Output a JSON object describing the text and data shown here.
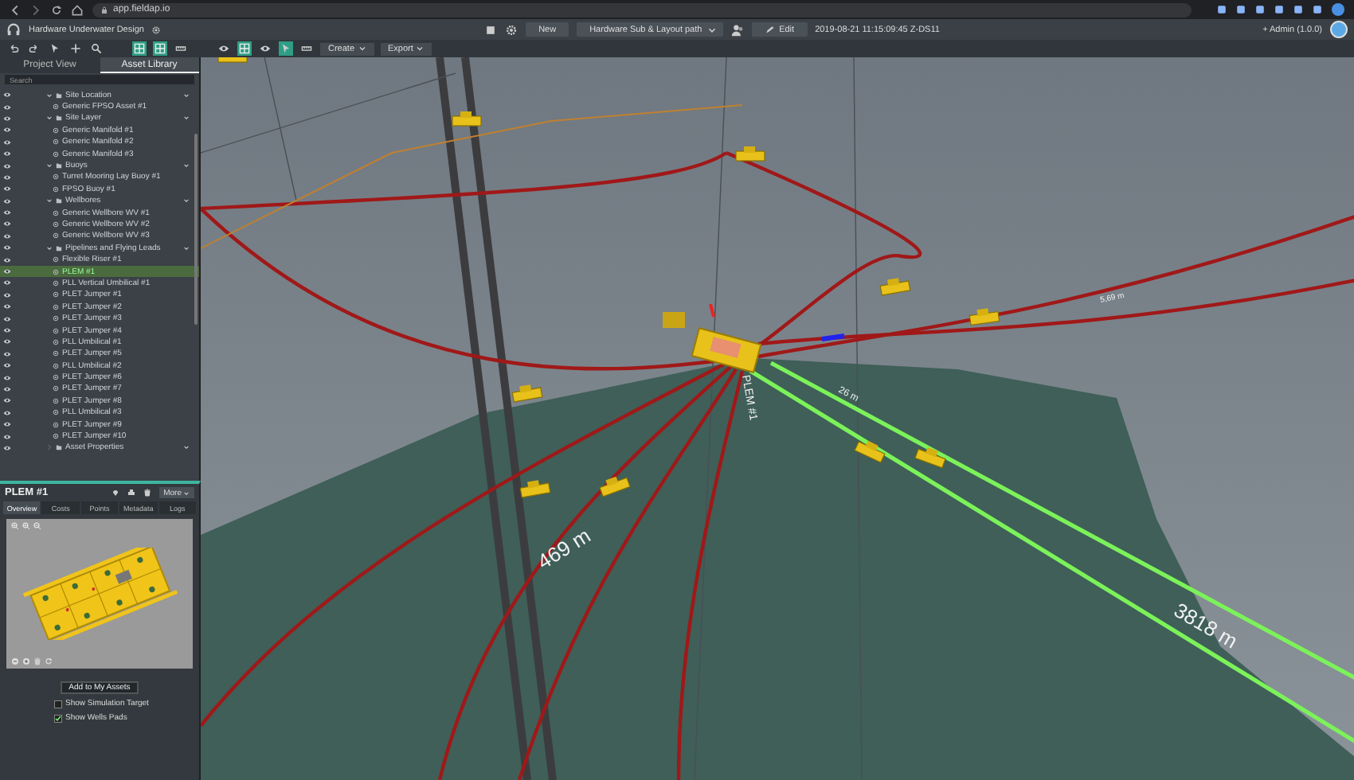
{
  "browser": {
    "url": "app.fieldap.io"
  },
  "header": {
    "project": "Hardware Underwater Design",
    "new_button": "New",
    "layout_select": "Hardware Sub & Layout path",
    "edit_button": "Edit",
    "timestamp": "2019-08-21 11:15:09:45 Z-DS11",
    "user": "+ Admin (1.0.0)"
  },
  "toolbar": {
    "tools": [
      {
        "kind": "undo",
        "selected": false
      },
      {
        "kind": "redo",
        "selected": false
      },
      {
        "kind": "pointer",
        "selected": false
      },
      {
        "kind": "pan",
        "selected": false
      },
      {
        "kind": "zoom",
        "selected": false
      },
      {
        "kind": "grid",
        "selected": true
      },
      {
        "kind": "grid",
        "selected": true
      },
      {
        "kind": "measure",
        "selected": false
      },
      {
        "kind": "eye",
        "selected": false
      },
      {
        "kind": "grid",
        "selected": true
      },
      {
        "kind": "eye",
        "selected": false
      },
      {
        "kind": "pointer",
        "selected": true
      },
      {
        "kind": "measure",
        "selected": false
      }
    ],
    "menus": [
      "Create",
      "Export"
    ]
  },
  "sidebar": {
    "tabs": [
      {
        "label": "Project View",
        "selected": false
      },
      {
        "label": "Asset Library",
        "selected": true
      }
    ],
    "search": {
      "placeholder": "Search"
    },
    "tree": [
      {
        "label": "Site Location",
        "expanded": true,
        "children": [
          {
            "label": "Generic FPSO Asset #1",
            "selected": false
          }
        ]
      },
      {
        "label": "Site Layer",
        "expanded": true,
        "children": [
          {
            "label": "Generic Manifold #1",
            "selected": false
          },
          {
            "label": "Generic Manifold #2",
            "selected": false
          },
          {
            "label": "Generic Manifold #3",
            "selected": false
          }
        ]
      },
      {
        "label": "Buoys",
        "expanded": true,
        "children": [
          {
            "label": "Turret Mooring Lay Buoy #1",
            "selected": false
          },
          {
            "label": "FPSO Buoy #1",
            "selected": false
          }
        ]
      },
      {
        "label": "Wellbores",
        "expanded": true,
        "children": [
          {
            "label": "Generic Wellbore WV #1",
            "selected": false
          },
          {
            "label": "Generic Wellbore WV #2",
            "selected": false
          },
          {
            "label": "Generic Wellbore WV #3",
            "selected": false
          }
        ]
      },
      {
        "label": "Pipelines and Flying Leads",
        "expanded": true,
        "children": [
          {
            "label": "Flexible Riser #1",
            "selected": false
          },
          {
            "label": "PLEM #1",
            "selected": true
          },
          {
            "label": "PLL Vertical Umbilical #1",
            "selected": false
          },
          {
            "label": "PLET Jumper #1",
            "selected": false
          },
          {
            "label": "PLET Jumper #2",
            "selected": false
          },
          {
            "label": "PLET Jumper #3",
            "selected": false
          },
          {
            "label": "PLET Jumper #4",
            "selected": false
          },
          {
            "label": "PLL Umbilical #1",
            "selected": false
          },
          {
            "label": "PLET Jumper #5",
            "selected": false
          },
          {
            "label": "PLL Umbilical #2",
            "selected": false
          },
          {
            "label": "PLET Jumper #6",
            "selected": false
          },
          {
            "label": "PLET Jumper #7",
            "selected": false
          },
          {
            "label": "PLET Jumper #8",
            "selected": false
          },
          {
            "label": "PLL Umbilical #3",
            "selected": false
          },
          {
            "label": "PLET Jumper #9",
            "selected": false
          },
          {
            "label": "PLET Jumper #10",
            "selected": false
          }
        ]
      },
      {
        "label": "Asset Properties",
        "expanded": false
      }
    ]
  },
  "asset_panel": {
    "title": "PLEM #1",
    "more_button": "More",
    "tabs": [
      {
        "label": "Overview",
        "selected": true
      },
      {
        "label": "Costs",
        "selected": false
      },
      {
        "label": "Points",
        "selected": false
      },
      {
        "label": "Metadata",
        "selected": false
      },
      {
        "label": "Logs",
        "selected": false
      }
    ],
    "add_button": "Add to My Assets",
    "options": [
      {
        "label": "Show Simulation Target",
        "checked": false
      },
      {
        "label": "Show Wells Pads",
        "checked": true
      }
    ]
  },
  "scene": {
    "labels": [
      {
        "text": "469 m",
        "kind": "distance"
      },
      {
        "text": "3818 m",
        "kind": "distance"
      },
      {
        "text": "26 m",
        "kind": "distance"
      },
      {
        "text": "PLEM #1",
        "kind": "name"
      },
      {
        "text": "5,69 m",
        "kind": "distance"
      }
    ]
  }
}
